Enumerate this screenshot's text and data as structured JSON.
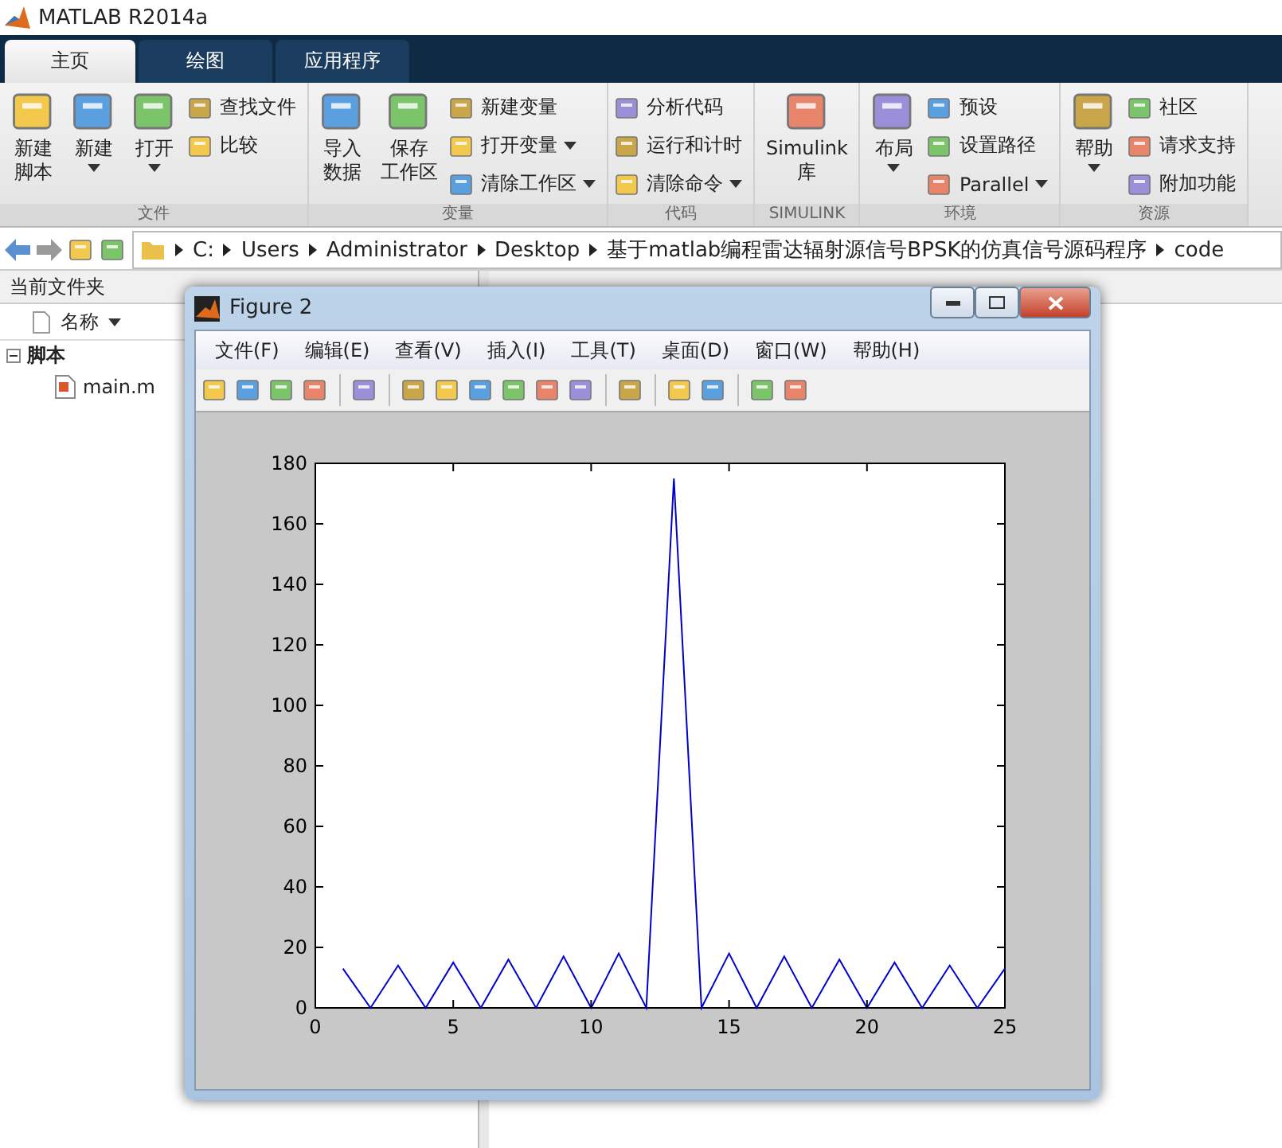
{
  "window": {
    "title": "MATLAB R2014a"
  },
  "tabs": [
    {
      "label": "主页",
      "selected": true
    },
    {
      "label": "绘图",
      "selected": false
    },
    {
      "label": "应用程序",
      "selected": false
    }
  ],
  "groups": [
    {
      "label": "文件",
      "items": [
        {
          "kind": "large",
          "lines": [
            "新建",
            "脚本"
          ],
          "dropdown": false
        },
        {
          "kind": "large",
          "lines": [
            "新建"
          ],
          "dropdown": true
        },
        {
          "kind": "large",
          "lines": [
            "打开"
          ],
          "dropdown": true
        },
        {
          "kind": "small",
          "label": "查找文件",
          "dropdown": false
        },
        {
          "kind": "small",
          "label": "比较",
          "dropdown": false
        }
      ]
    },
    {
      "label": "变量",
      "items": [
        {
          "kind": "large",
          "lines": [
            "导入",
            "数据"
          ],
          "dropdown": false
        },
        {
          "kind": "large",
          "lines": [
            "保存",
            "工作区"
          ],
          "dropdown": false
        },
        {
          "kind": "small",
          "label": "新建变量",
          "dropdown": false
        },
        {
          "kind": "small",
          "label": "打开变量",
          "dropdown": true
        },
        {
          "kind": "small",
          "label": "清除工作区",
          "dropdown": true
        }
      ]
    },
    {
      "label": "代码",
      "items": [
        {
          "kind": "small",
          "label": "分析代码",
          "dropdown": false
        },
        {
          "kind": "small",
          "label": "运行和计时",
          "dropdown": false
        },
        {
          "kind": "small",
          "label": "清除命令",
          "dropdown": true
        }
      ]
    },
    {
      "label": "SIMULINK",
      "items": [
        {
          "kind": "large",
          "lines": [
            "Simulink",
            "库"
          ],
          "dropdown": false
        }
      ]
    },
    {
      "label": "环境",
      "items": [
        {
          "kind": "large",
          "lines": [
            "布局"
          ],
          "dropdown": true
        },
        {
          "kind": "small",
          "label": "预设",
          "dropdown": false
        },
        {
          "kind": "small",
          "label": "设置路径",
          "dropdown": false
        },
        {
          "kind": "small",
          "label": "Parallel",
          "dropdown": true
        }
      ]
    },
    {
      "label": "资源",
      "items": [
        {
          "kind": "large",
          "lines": [
            "帮助"
          ],
          "dropdown": true
        },
        {
          "kind": "small",
          "label": "社区",
          "dropdown": false
        },
        {
          "kind": "small",
          "label": "请求支持",
          "dropdown": false
        },
        {
          "kind": "small",
          "label": "附加功能",
          "dropdown": false
        }
      ]
    }
  ],
  "path": [
    "C:",
    "Users",
    "Administrator",
    "Desktop",
    "基于matlab编程雷达辐射源信号BPSK的仿真信号源码程序",
    "code"
  ],
  "file_panel": {
    "title": "当前文件夹",
    "column": "名称",
    "tree": [
      {
        "label": "脚本",
        "expanded": true,
        "children": [
          {
            "label": "main.m"
          }
        ]
      }
    ]
  },
  "figure": {
    "title": "Figure 2",
    "menu": [
      "文件(F)",
      "编辑(E)",
      "查看(V)",
      "插入(I)",
      "工具(T)",
      "桌面(D)",
      "窗口(W)",
      "帮助(H)"
    ],
    "chart_data": {
      "type": "line",
      "x": [
        1,
        2,
        3,
        4,
        5,
        6,
        7,
        8,
        9,
        10,
        11,
        12,
        13,
        14,
        15,
        16,
        17,
        18,
        19,
        20,
        21,
        22,
        23,
        24,
        25
      ],
      "series": [
        {
          "color": "#0000cc",
          "values": [
            13,
            0,
            14,
            0,
            15,
            0,
            16,
            0,
            17,
            0,
            18,
            0,
            175,
            0,
            18,
            0,
            17,
            0,
            16,
            0,
            15,
            0,
            14,
            0,
            13
          ]
        }
      ],
      "xlim": [
        0,
        25
      ],
      "ylim": [
        0,
        180
      ],
      "xticks": [
        0,
        5,
        10,
        15,
        20,
        25
      ],
      "yticks": [
        0,
        20,
        40,
        60,
        80,
        100,
        120,
        140,
        160,
        180
      ]
    }
  }
}
